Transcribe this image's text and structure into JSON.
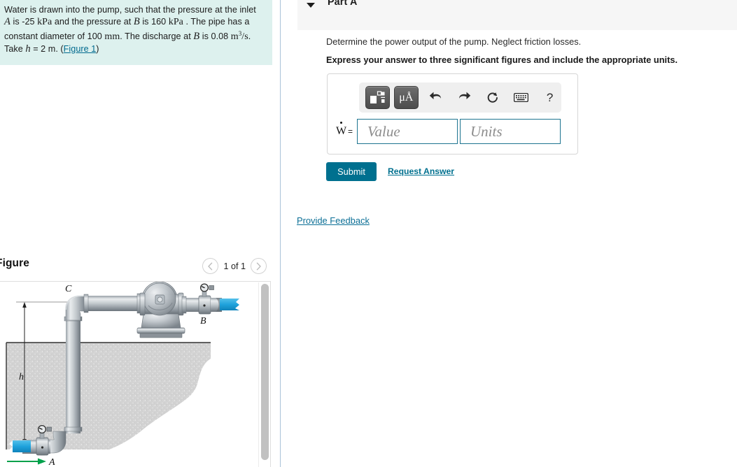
{
  "problem": {
    "text_part1": "Water is drawn into the pump, such that the pressure at the inlet ",
    "var_A": "A",
    "text_part2": " is -25 ",
    "unit_kpa1": "kPa",
    "text_part3": " and the pressure at ",
    "var_B": "B",
    "text_part4": " is 160 ",
    "unit_kpa2": "kPa",
    "text_part5": " . The pipe has a constant diameter of 100 ",
    "unit_mm": "mm",
    "text_part6": ". The discharge at ",
    "var_B2": "B",
    "text_part7": " is 0.08 ",
    "unit_m3": "m",
    "exp_3": "3",
    "unit_per_s": "/s",
    "text_part8": ". Take ",
    "var_h": "h",
    "text_part9": " = 2 m. (",
    "figure_link": "Figure 1",
    "text_part10": ")"
  },
  "figure": {
    "title": "Figure",
    "count_label": "1 of 1",
    "prev_icon": "chevron-left-icon",
    "next_icon": "chevron-right-icon",
    "labels": {
      "point_a": "A",
      "point_b": "B",
      "point_c": "C",
      "height": "h"
    },
    "colors": {
      "pipe_light": "#e3e6e8",
      "pipe_mid": "#b5bcc2",
      "pipe_dark": "#6f777e",
      "water": "#29a8df",
      "ground": "#d0d0d0",
      "arrow_green": "#00a14b"
    }
  },
  "part_a": {
    "title": "Part A",
    "caret_icon": "caret-down-icon",
    "question": "Determine the power output of the pump. Neglect friction losses.",
    "instruction": "Express your answer to three significant figures and include the appropriate units."
  },
  "answer": {
    "symbol": "W",
    "equals": "=",
    "value_placeholder": "Value",
    "units_placeholder": "Units",
    "value_current": "",
    "units_current": "",
    "border_color": "#1d7490"
  },
  "toolbar": {
    "items": [
      {
        "name": "math-template-icon",
        "type": "dark"
      },
      {
        "name": "units-micro-angstrom-icon",
        "type": "dark",
        "label": "μÅ"
      },
      {
        "name": "undo-icon",
        "type": "flat"
      },
      {
        "name": "redo-icon",
        "type": "flat"
      },
      {
        "name": "reset-icon",
        "type": "flat"
      },
      {
        "name": "keyboard-icon",
        "type": "flat"
      },
      {
        "name": "help-icon",
        "type": "flat",
        "label": "?"
      }
    ]
  },
  "actions": {
    "submit_label": "Submit",
    "request_answer_label": "Request Answer",
    "provide_feedback_label": "Provide Feedback",
    "submit_color": "#00708f",
    "link_color": "#0b6f96"
  }
}
